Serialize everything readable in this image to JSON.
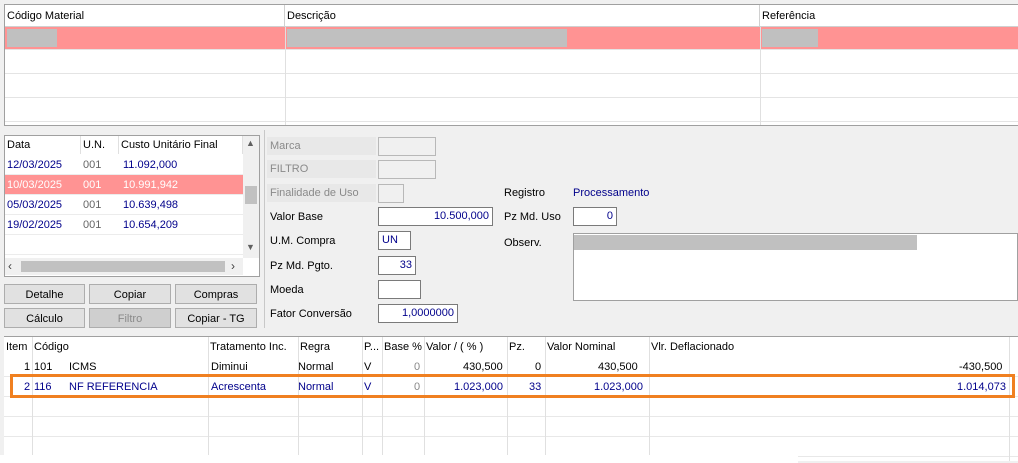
{
  "top_grid": {
    "columns": [
      "Código Material",
      "Descrição",
      "Referência"
    ],
    "selected_row_color": "#ff9393"
  },
  "history": {
    "columns": [
      "Data",
      "U.N.",
      "Custo Unitário Final"
    ],
    "rows": [
      {
        "data": "12/03/2025",
        "un": "001",
        "custo": "11.092,000"
      },
      {
        "data": "10/03/2025",
        "un": "001",
        "custo": "10.991,942"
      },
      {
        "data": "05/03/2025",
        "un": "001",
        "custo": "10.639,498"
      },
      {
        "data": "19/02/2025",
        "un": "001",
        "custo": "10.654,209"
      }
    ],
    "selected_index": 1,
    "scroll_left_icon": "chevron-left-icon",
    "scroll_right_icon": "chevron-right-icon",
    "scroll_up_icon": "chevron-up-icon",
    "scroll_down_icon": "chevron-down-icon"
  },
  "buttons": {
    "detalhe": "Detalhe",
    "copiar": "Copiar",
    "compras": "Compras",
    "calculo": "Cálculo",
    "filtro": "Filtro",
    "copiar_tg": "Copiar - TG"
  },
  "form": {
    "marca_label": "Marca",
    "filtro_label": "FILTRO",
    "finalidade_label": "Finalidade de Uso",
    "registro_label": "Registro",
    "registro_value": "Processamento",
    "valor_base_label": "Valor Base",
    "valor_base_value": "10.500,000",
    "pz_md_uso_label": "Pz Md. Uso",
    "pz_md_uso_value": "0",
    "um_compra_label": "U.M. Compra",
    "um_compra_value": "UN",
    "observ_label": "Observ.",
    "pz_md_pgto_label": "Pz Md. Pgto.",
    "pz_md_pgto_value": "33",
    "moeda_label": "Moeda",
    "moeda_value": "",
    "fator_label": "Fator Conversão",
    "fator_value": "1,0000000"
  },
  "bottom_grid": {
    "columns": [
      "Item",
      "Código",
      "Tratamento Inc.",
      "Regra",
      "P...",
      "Base %",
      "Valor / ( % )",
      "Pz.",
      "Valor Nominal",
      "Vlr. Deflacionado"
    ],
    "rows": [
      {
        "item": "1",
        "codigo": "101",
        "nome": "ICMS",
        "tratamento": "Diminui",
        "regra": "Normal",
        "p": "V",
        "base": "0",
        "valor": "430,500",
        "pz": "0",
        "nominal": "430,500",
        "deflacionado": "-430,500"
      },
      {
        "item": "2",
        "codigo": "116",
        "nome": "NF REFERENCIA",
        "tratamento": "Acrescenta",
        "regra": "Normal",
        "p": "V",
        "base": "0",
        "valor": "1.023,000",
        "pz": "33",
        "nominal": "1.023,000",
        "deflacionado": "1.014,073"
      }
    ],
    "highlight_color": "#f08020"
  }
}
